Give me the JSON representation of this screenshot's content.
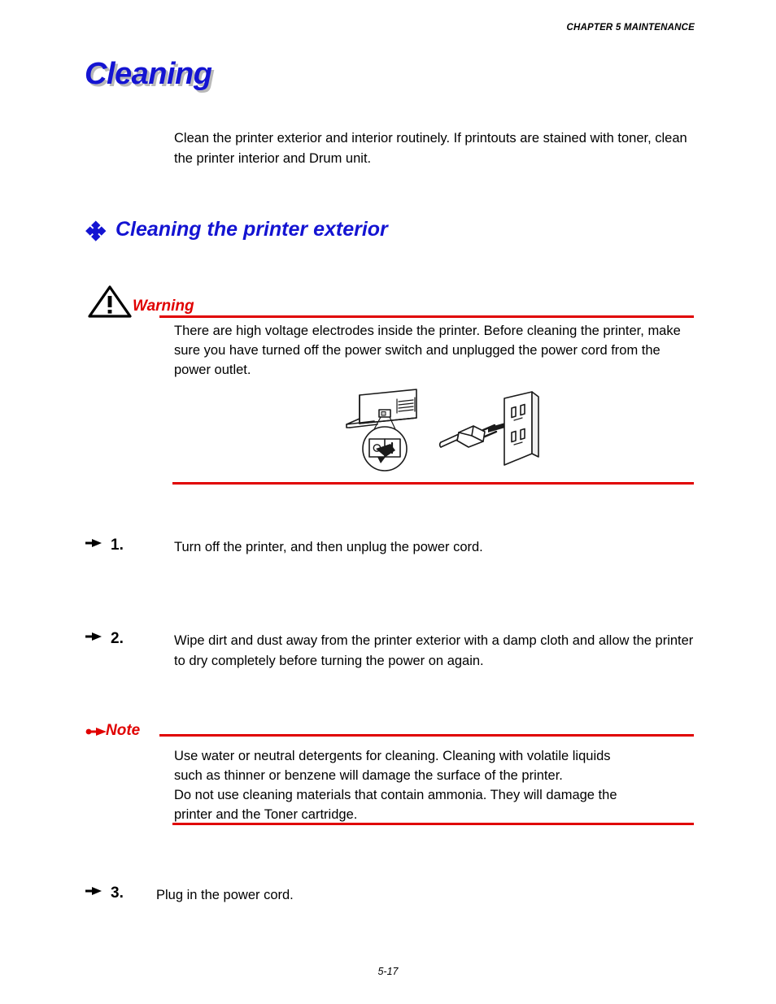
{
  "header": {
    "running_head": "CHAPTER 5 MAINTENANCE"
  },
  "title": {
    "text": "Cleaning",
    "color": "#1414d2",
    "shadow_color": "#b9b9b9"
  },
  "intro": {
    "text": "Clean the printer exterior and interior routinely. If printouts are stained with toner, clean the printer interior and Drum unit."
  },
  "section": {
    "heading": "Cleaning the printer exterior",
    "bullet_icon": "floret-diamond-icon",
    "color": "#1414d2"
  },
  "warning": {
    "label": "Warning",
    "icon": "warning-triangle-icon",
    "color": "#e00000",
    "body": "There are high voltage electrodes inside the printer.  Before cleaning the printer, make sure you have turned off the power switch and unplugged the power cord from the power outlet.",
    "illustration": {
      "name": "power-switch-and-unplug-illustration",
      "parts": [
        "printer-power-switch-magnified",
        "plug-removed-from-wall-outlet"
      ]
    }
  },
  "note": {
    "label": "Note",
    "icon": "note-pointer-icon",
    "color": "#e00000",
    "body_lines": [
      "Use water or neutral detergents for cleaning. Cleaning with volatile liquids",
      "such as thinner or benzene will damage the surface of the printer.",
      "Do not use cleaning materials that contain ammonia. They will damage the",
      "printer and the Toner cartridge."
    ]
  },
  "steps": [
    {
      "number": "1.",
      "marker_icon": "pointing-hand-icon",
      "text": "Turn off the printer, and then unplug the power cord."
    },
    {
      "number": "2.",
      "marker_icon": "pointing-hand-icon",
      "text": "Wipe dirt and dust away from the printer exterior with a damp cloth and allow the printer to dry completely before turning the power on again."
    },
    {
      "number": "3.",
      "marker_icon": "pointing-hand-icon",
      "text": "Plug in the power cord."
    }
  ],
  "footer": {
    "page_number": "5-17"
  }
}
